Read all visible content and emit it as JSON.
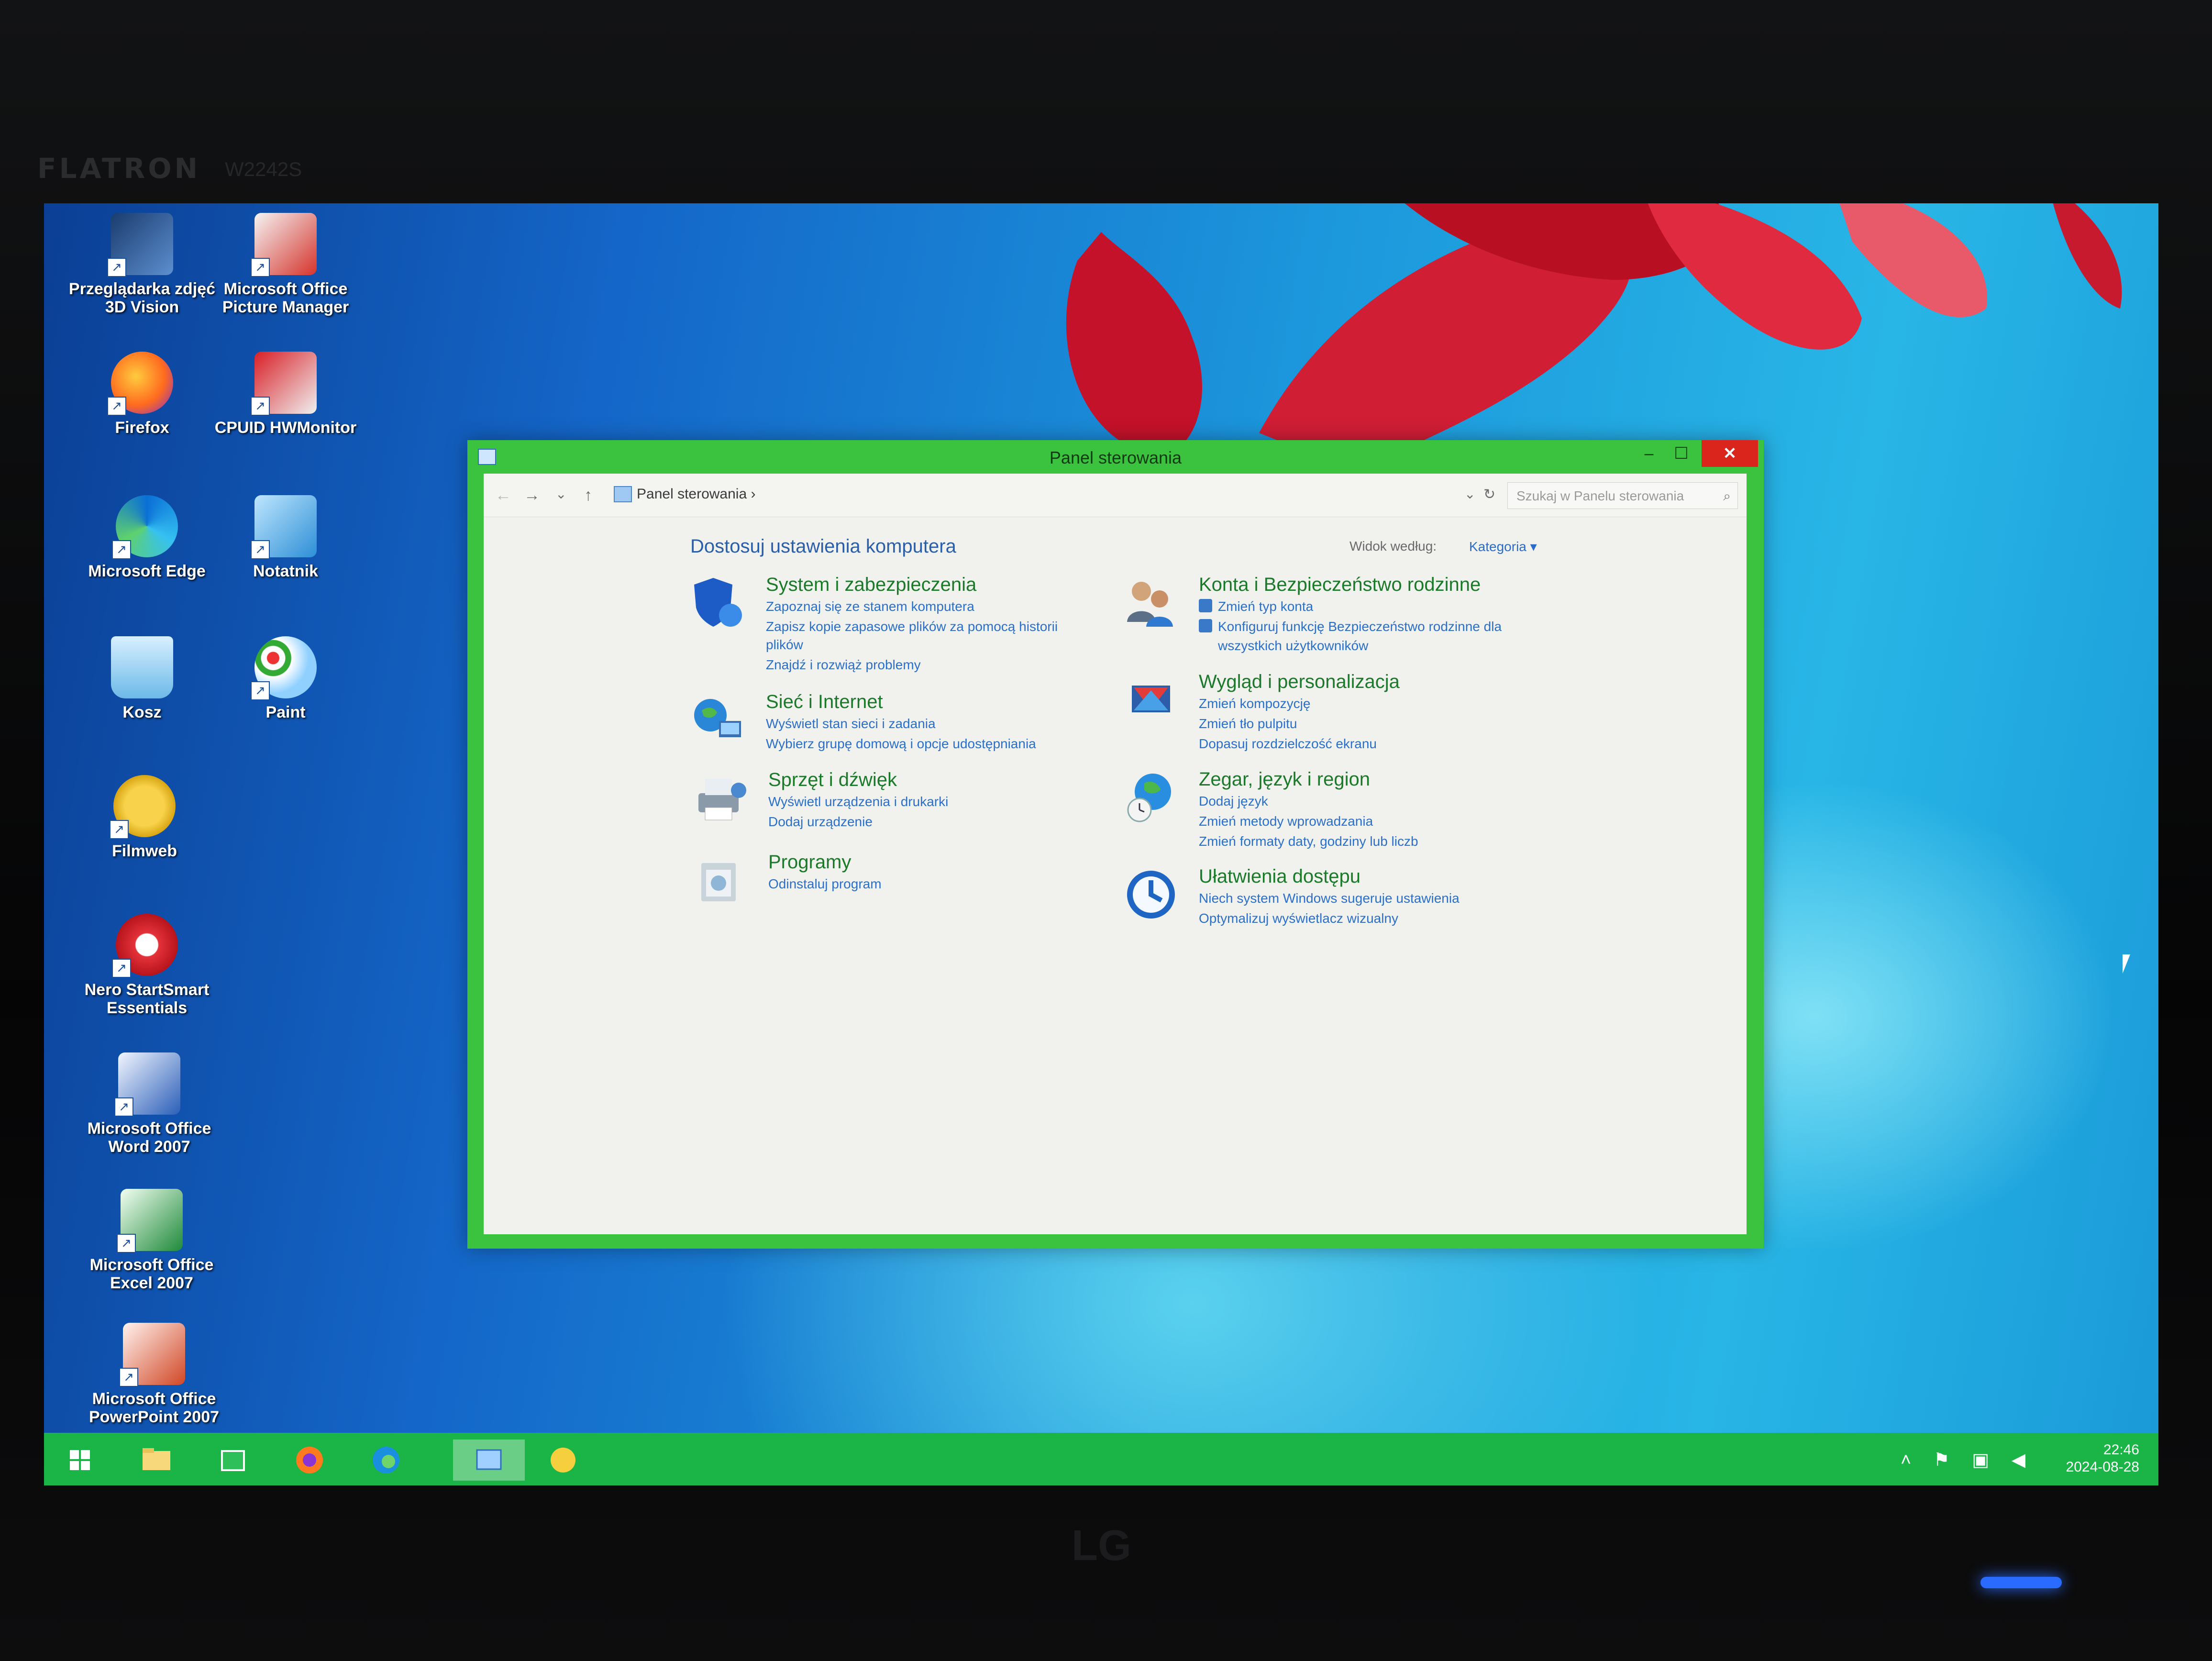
{
  "monitor": {
    "brand": "FLATRON",
    "model": "W2242S",
    "logo": "LG"
  },
  "desktop": {
    "icons": [
      {
        "label": "Przeglądarka zdjęć 3D Vision",
        "icon": "3d-vision-photo-viewer-icon"
      },
      {
        "label": "Microsoft Office Picture Manager",
        "icon": "picture-manager-icon"
      },
      {
        "label": "Firefox",
        "icon": "firefox-icon"
      },
      {
        "label": "CPUID HWMonitor",
        "icon": "hwmonitor-icon"
      },
      {
        "label": "Microsoft Edge",
        "icon": "edge-icon"
      },
      {
        "label": "Notatnik",
        "icon": "notepad-icon"
      },
      {
        "label": "Kosz",
        "icon": "recycle-bin-icon"
      },
      {
        "label": "Paint",
        "icon": "paint-icon"
      },
      {
        "label": "Filmweb",
        "icon": "filmweb-icon"
      },
      {
        "label": "Nero StartSmart Essentials",
        "icon": "nero-icon"
      },
      {
        "label": "Microsoft Office Word 2007",
        "icon": "word-icon"
      },
      {
        "label": "Microsoft Office Excel 2007",
        "icon": "excel-icon"
      },
      {
        "label": "Microsoft Office PowerPoint 2007",
        "icon": "powerpoint-icon"
      }
    ]
  },
  "window": {
    "title": "Panel sterowania",
    "controls": {
      "minimize": "–",
      "maximize": "☐",
      "close": "✕"
    },
    "nav": {
      "back": "←",
      "forward": "→",
      "recent": "⌄",
      "up": "↑",
      "refresh": "↻",
      "dropdown": "⌄"
    },
    "breadcrumb": {
      "item": "Panel sterowania",
      "sep": "›"
    },
    "search": {
      "placeholder": "Szukaj w Panelu sterowania",
      "icon": "⌕"
    },
    "heading": "Dostosuj ustawienia komputera",
    "view_by_label": "Widok według:",
    "view_by_value": "Kategoria ▾",
    "categories_left": [
      {
        "title": "System i zabezpieczenia",
        "links": [
          "Zapoznaj się ze stanem komputera",
          "Zapisz kopie zapasowe plików za pomocą historii",
          "plików",
          "Znajdź i rozwiąż problemy"
        ]
      },
      {
        "title": "Sieć i Internet",
        "links": [
          "Wyświetl stan sieci i zadania",
          "Wybierz grupę domową i opcje udostępniania"
        ]
      },
      {
        "title": "Sprzęt i dźwięk",
        "links": [
          "Wyświetl urządzenia i drukarki",
          "Dodaj urządzenie"
        ]
      },
      {
        "title": "Programy",
        "links": [
          "Odinstaluj program"
        ]
      }
    ],
    "categories_right": [
      {
        "title": "Konta i Bezpieczeństwo rodzinne",
        "links": [
          "Zmień typ konta",
          "Konfiguruj funkcję Bezpieczeństwo rodzinne dla",
          "wszystkich użytkowników"
        ]
      },
      {
        "title": "Wygląd i personalizacja",
        "links": [
          "Zmień kompozycję",
          "Zmień tło pulpitu",
          "Dopasuj rozdzielczość ekranu"
        ]
      },
      {
        "title": "Zegar, język i region",
        "links": [
          "Dodaj język",
          "Zmień metody wprowadzania",
          "Zmień formaty daty, godziny lub liczb"
        ]
      },
      {
        "title": "Ułatwienia dostępu",
        "links": [
          "Niech system Windows sugeruje ustawienia",
          "Optymalizuj wyświetlacz wizualny"
        ]
      }
    ]
  },
  "taskbar": {
    "items": [
      "start-icon",
      "file-explorer-icon",
      "store-icon",
      "firefox-icon",
      "edge-icon",
      "control-panel-icon",
      "filmweb-icon"
    ],
    "time": "22:46",
    "date": "2024-08-28",
    "tray": "˄ ⚑ ▣ ◀"
  },
  "colors": {
    "accent": "#3bc23f",
    "link": "#2a6fc9",
    "category_title": "#1b7a2a",
    "close": "#d9251c"
  }
}
